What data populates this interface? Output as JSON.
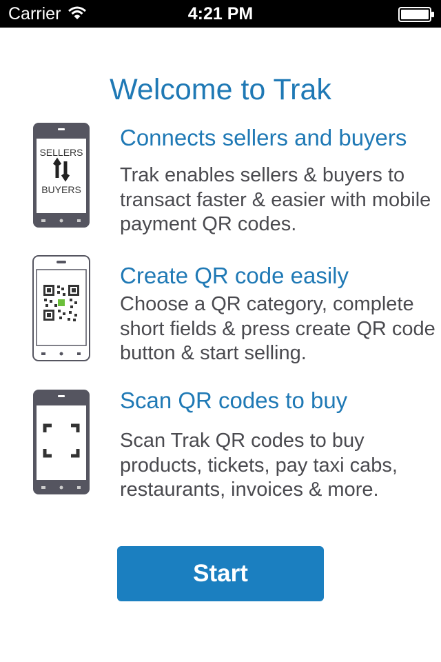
{
  "status_bar": {
    "carrier": "Carrier",
    "time": "4:21 PM"
  },
  "title": "Welcome to Trak",
  "features": [
    {
      "icon": "sellers-buyers-phone-icon",
      "title": "Connects sellers and buyers",
      "description": "Trak enables sellers & buyers to transact faster & easier with mobile payment QR codes.",
      "icon_text_top": "SELLERS",
      "icon_text_bottom": "BUYERS"
    },
    {
      "icon": "qr-code-phone-icon",
      "title": "Create QR code easily",
      "description": "Choose a QR category, complete short fields & press create QR code button & start selling."
    },
    {
      "icon": "scan-phone-icon",
      "title": "Scan QR codes to buy",
      "description": "Scan Trak QR codes to buy products, tickets, pay taxi cabs, restaurants, invoices & more."
    }
  ],
  "start_button": {
    "label": "Start"
  },
  "colors": {
    "accent": "#1f79b5",
    "button": "#1b7fc0",
    "phone_body": "#555560",
    "text": "#4a4a4f"
  }
}
